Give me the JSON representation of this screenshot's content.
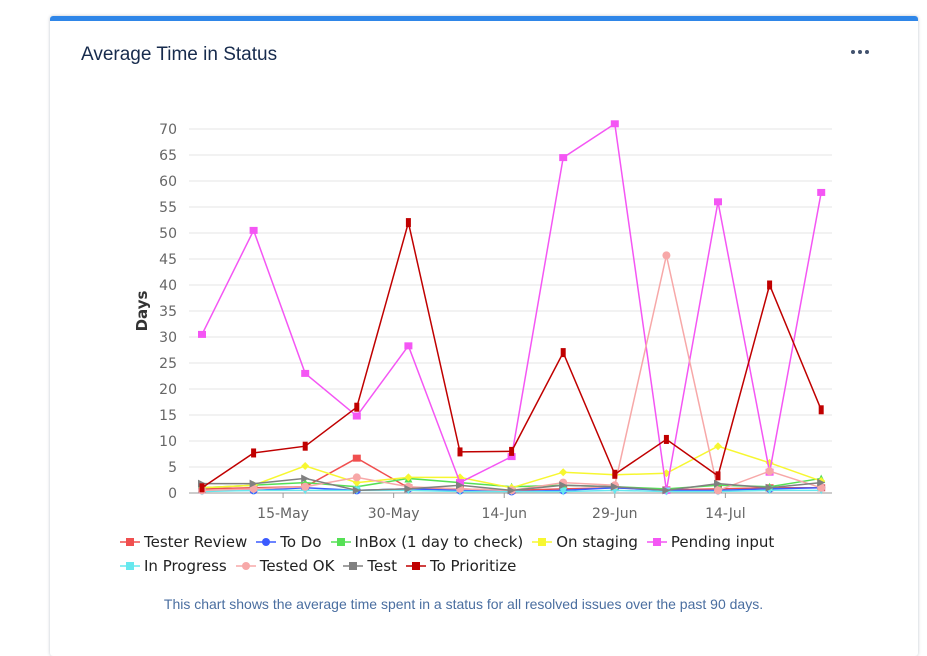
{
  "widget": {
    "title": "Average Time in Status",
    "menu_icon": "more-horizontal-icon"
  },
  "caption": "This chart shows the average time spent in a status for all resolved issues over the past 90 days.",
  "chart_data": {
    "type": "line",
    "ylabel": "Days",
    "xlabel": "",
    "ylim": [
      0,
      70
    ],
    "yticks": [
      0,
      5,
      10,
      15,
      20,
      25,
      30,
      35,
      40,
      45,
      50,
      55,
      60,
      65,
      70
    ],
    "x_tick_labels": [
      "15-May",
      "30-May",
      "14-Jun",
      "29-Jun",
      "14-Jul"
    ],
    "x": [
      "2024-05-04",
      "2024-05-11",
      "2024-05-18",
      "2024-05-25",
      "2024-06-01",
      "2024-06-08",
      "2024-06-15",
      "2024-06-22",
      "2024-06-29",
      "2024-07-06",
      "2024-07-13",
      "2024-07-20",
      "2024-07-27"
    ],
    "grid": true,
    "legend_position": "bottom",
    "series": [
      {
        "name": "Tester Review",
        "color": "#f04f4f",
        "marker": "square",
        "values": [
          0.8,
          1,
          1.2,
          6.7,
          1,
          0.8,
          0.5,
          0.8,
          1,
          0.6,
          0.8,
          1,
          1
        ]
      },
      {
        "name": "To Do",
        "color": "#3b5bff",
        "marker": "circle",
        "values": [
          0.5,
          0.5,
          1,
          0.5,
          0.8,
          0.5,
          0.3,
          0.5,
          1,
          0.5,
          0.5,
          0.8,
          1
        ]
      },
      {
        "name": "InBox (1 day to check)",
        "color": "#55e055",
        "marker": "triangle",
        "values": [
          1,
          1.5,
          2,
          1.2,
          2.8,
          2,
          1.2,
          1.5,
          1.2,
          0.8,
          1.5,
          1.2,
          2.8
        ]
      },
      {
        "name": "On staging",
        "color": "#f7f731",
        "marker": "diamond",
        "values": [
          1,
          1.5,
          5.2,
          2,
          3,
          3,
          1,
          4,
          3.5,
          3.8,
          9,
          5.8,
          2.3
        ]
      },
      {
        "name": "Pending input",
        "color": "#f456f4",
        "marker": "square",
        "values": [
          30.5,
          50.5,
          23,
          14.8,
          28.3,
          2,
          7,
          64.5,
          71,
          0.5,
          56,
          4,
          57.8
        ]
      },
      {
        "name": "In Progress",
        "color": "#66e8ee",
        "marker": "triangle-down",
        "values": [
          0.3,
          0.5,
          0.5,
          0.5,
          0.5,
          0.3,
          0.3,
          0.3,
          0.5,
          0.3,
          0.3,
          0.5,
          0.5
        ]
      },
      {
        "name": "Tested OK",
        "color": "#f7a8a8",
        "marker": "circle",
        "values": [
          0.5,
          0.8,
          1.2,
          3,
          1.2,
          0.8,
          0.5,
          2,
          1.5,
          45.7,
          0.5,
          4.2,
          1
        ]
      },
      {
        "name": "Test",
        "color": "#808080",
        "marker": "arrow",
        "values": [
          1.8,
          1.8,
          2.8,
          0.5,
          0.8,
          1.5,
          0.5,
          1.5,
          1.2,
          0.5,
          1.8,
          1,
          2
        ]
      },
      {
        "name": "To Prioritize",
        "color": "#c00000",
        "marker": "bar",
        "values": [
          1,
          7.7,
          9,
          16.5,
          52,
          7.9,
          8,
          27,
          3.6,
          10.3,
          3.3,
          40,
          16
        ]
      }
    ]
  }
}
